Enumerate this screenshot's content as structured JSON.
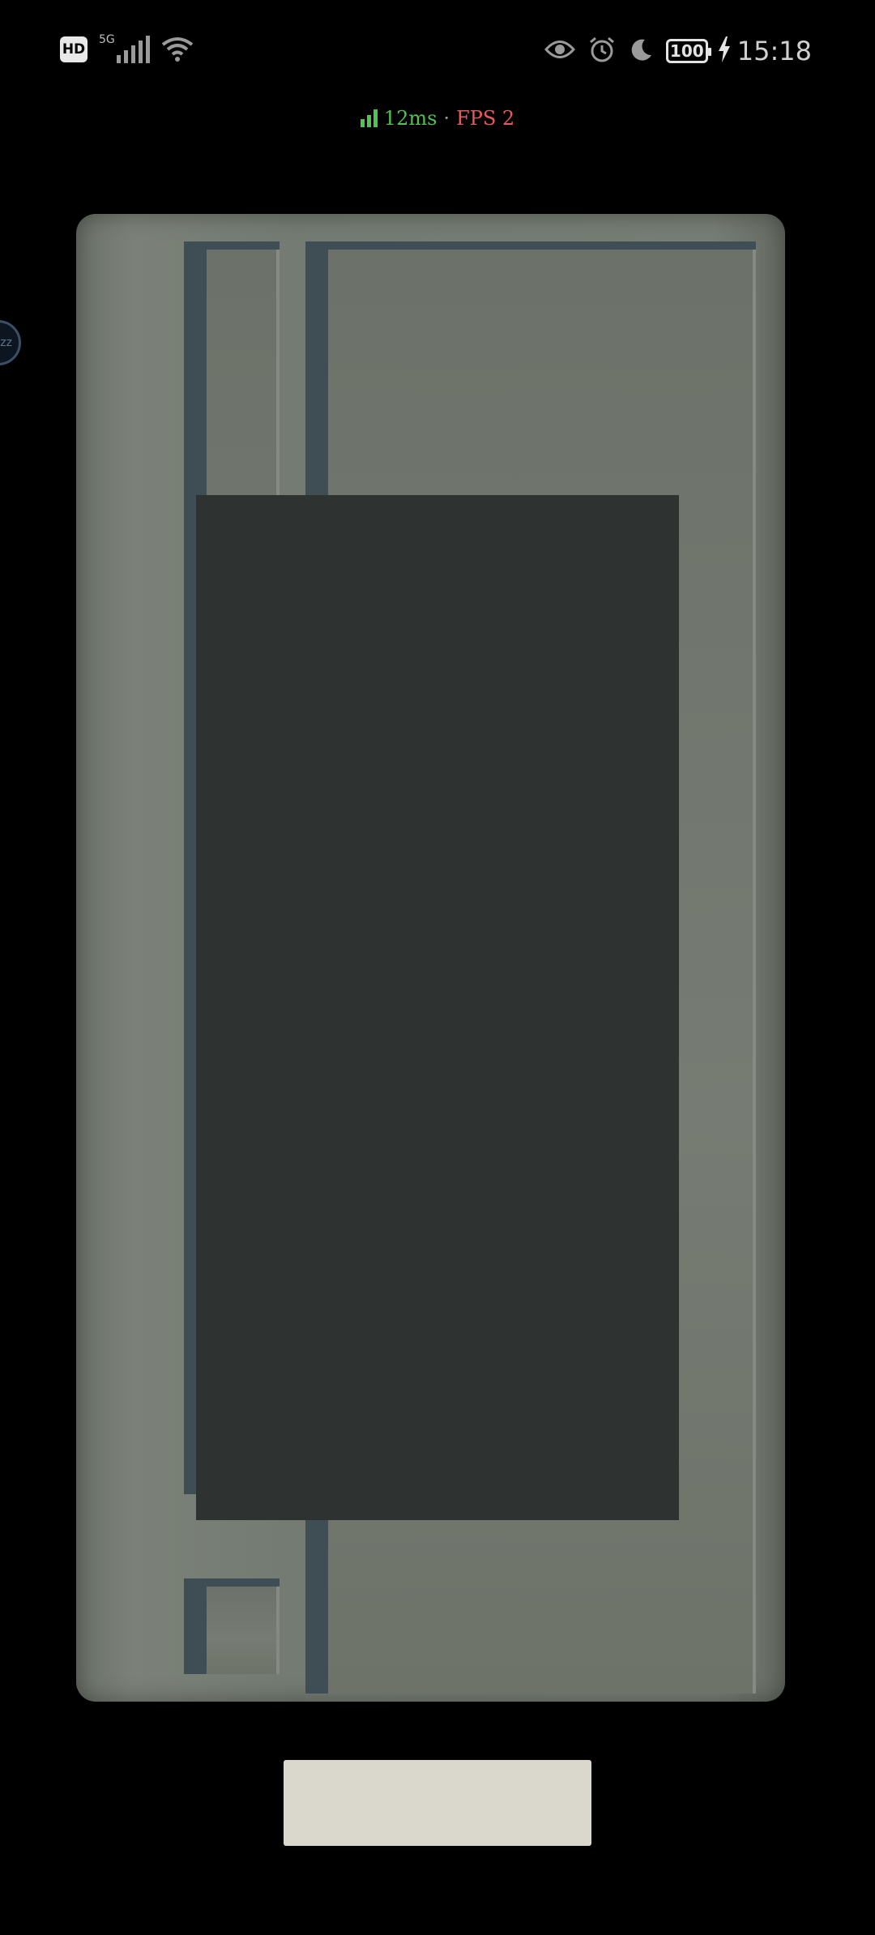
{
  "status_bar": {
    "hd_label": "HD",
    "network_type": "5G",
    "battery_level": "100",
    "time": "15:18",
    "icons": [
      "hd-icon",
      "signal-icon",
      "wifi-icon",
      "eye-icon",
      "alarm-icon",
      "moon-icon",
      "battery-icon",
      "charging-icon"
    ]
  },
  "perf_overlay": {
    "latency": "12ms",
    "separator": "·",
    "fps": "FPS 2"
  },
  "floating_bubble": {
    "label": "zz"
  },
  "colors": {
    "background": "#000000",
    "board": "#767d74",
    "wall": "#3f4d54",
    "overlay_panel": "#2e3231",
    "bottom_slot": "#dad8cd",
    "latency_green": "#4fc44f",
    "fps_red": "#e85a5a"
  }
}
